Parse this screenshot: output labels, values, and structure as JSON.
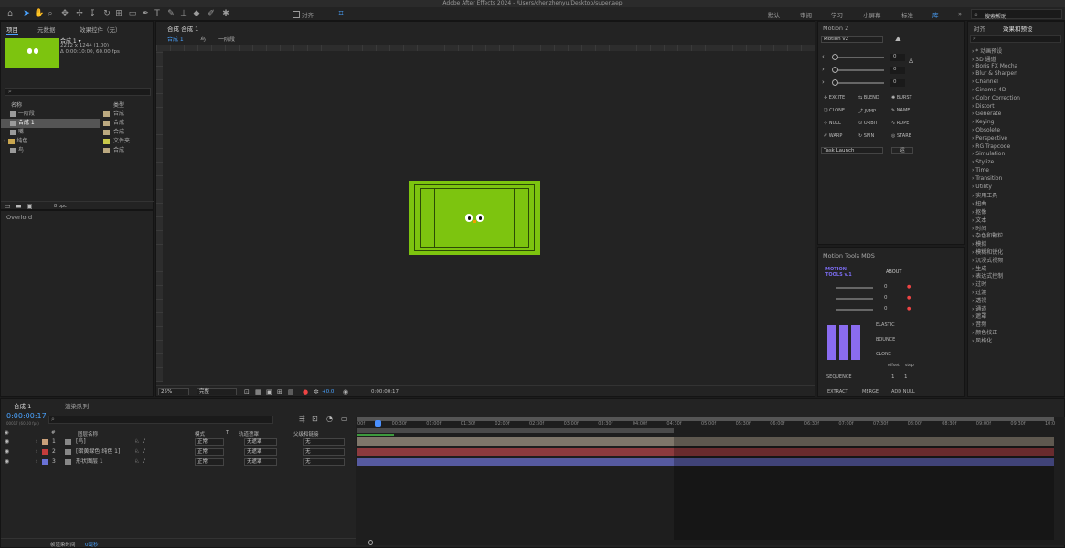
{
  "window": {
    "title": "Adobe After Effects 2024 - /Users/chenzhenyu/Desktop/super.aep"
  },
  "toolbar": {
    "snap_label": "对齐",
    "workspaces": [
      "默认",
      "审阅",
      "学习",
      "小屏幕",
      "标准",
      "库"
    ],
    "search_placeholder": "搜索帮助"
  },
  "project": {
    "tabs": [
      "项目",
      "元数据",
      "效果控件（无）"
    ],
    "comp_name": "合成 1 ▾",
    "comp_size": "2212 x 1244 (1.00)",
    "comp_duration": "Δ 0:00:10:00, 60.00 fps",
    "col_name": "名称",
    "col_type": "类型",
    "items": [
      {
        "name": "一阶段",
        "type": "合成"
      },
      {
        "name": "合成 1",
        "type": "合成"
      },
      {
        "name": "嘴",
        "type": "合成"
      },
      {
        "name": "纯色",
        "type": "文件夹"
      },
      {
        "name": "鸟",
        "type": "合成"
      }
    ],
    "bpc": "8 bpc",
    "overlord": "Overlord"
  },
  "comp": {
    "tab": "合成 合成 1",
    "breadcrumbs": [
      "合成 1",
      "鸟",
      "一阶段"
    ],
    "zoom": "25%",
    "quality": "完整",
    "timecode": "0:00:00:17",
    "exposure": "+0.0"
  },
  "motion2": {
    "title": "Motion 2",
    "preset": "Motion v2",
    "sliders": [
      "0",
      "0",
      "0"
    ],
    "buttons": [
      "EXCITE",
      "BLEND",
      "BURST",
      "CLONE",
      "JUMP",
      "NAME",
      "NULL",
      "ORBIT",
      "ROPE",
      "WARP",
      "SPIN",
      "STARE"
    ],
    "task": "Task Launch",
    "run": "运"
  },
  "mtools": {
    "title": "Motion Tools MDS",
    "logo": "MOTION TOOLS v.1",
    "about": "ABOUT",
    "vals": [
      "0",
      "0",
      "0"
    ],
    "elastic": "ELASTIC",
    "bounce": "BOUNCE",
    "clone": "CLONE",
    "offset": "offset",
    "step": "step",
    "sequence": "SEQUENCE",
    "seq_vals": [
      "1",
      "1"
    ],
    "extract": "EXTRACT",
    "merge": "MERGE",
    "addnull": "ADD NULL"
  },
  "effects": {
    "tabs": [
      "对齐",
      "效果和预设"
    ],
    "categories": [
      "* 动画预设",
      "3D 通道",
      "Boris FX Mocha",
      "Blur & Sharpen",
      "Channel",
      "Cinema 4D",
      "Color Correction",
      "Distort",
      "Generate",
      "Keying",
      "Obsolete",
      "Perspective",
      "RG Trapcode",
      "Simulation",
      "Stylize",
      "Time",
      "Transition",
      "Utility",
      "实用工具",
      "扭曲",
      "抠像",
      "文本",
      "时间",
      "杂色和颗粒",
      "模拟",
      "模糊和锐化",
      "沉浸式视频",
      "生成",
      "表达式控制",
      "过时",
      "过渡",
      "透视",
      "通道",
      "遮罩",
      "音频",
      "颜色校正",
      "风格化"
    ]
  },
  "timeline": {
    "tabs": [
      "合成 1",
      "渲染队列"
    ],
    "timecode": "0:00:00:17",
    "fps_hint": "00017 (60.00 fps)",
    "col_layer": "图层名称",
    "col_mode": "模式",
    "col_track": "轨道遮罩",
    "col_parent": "父级和链接",
    "t": "T",
    "layers": [
      {
        "num": "1",
        "name": "[鸟]",
        "mode": "正常",
        "track": "无遮罩",
        "parent": "无",
        "color": "#c9a07a"
      },
      {
        "num": "2",
        "name": "[暗黄绿色 纯色 1]",
        "mode": "正常",
        "track": "无遮罩",
        "parent": "无",
        "color": "#c43c3c"
      },
      {
        "num": "3",
        "name": "形状图层 1",
        "mode": "正常",
        "track": "无遮罩",
        "parent": "无",
        "color": "#6a72d6"
      }
    ],
    "ruler": [
      "00f",
      "00:30f",
      "01:00f",
      "01:30f",
      "02:00f",
      "02:30f",
      "03:00f",
      "03:30f",
      "04:00f",
      "04:30f",
      "05:00f",
      "05:30f",
      "06:00f",
      "06:30f",
      "07:00f",
      "07:30f",
      "08:00f",
      "08:30f",
      "09:00f",
      "09:30f",
      "10:0"
    ],
    "render_time_label": "帧渲染时间",
    "render_time": "0毫秒"
  },
  "colors": {
    "accent": "#2d8ceb",
    "green": "#7dc40f"
  }
}
